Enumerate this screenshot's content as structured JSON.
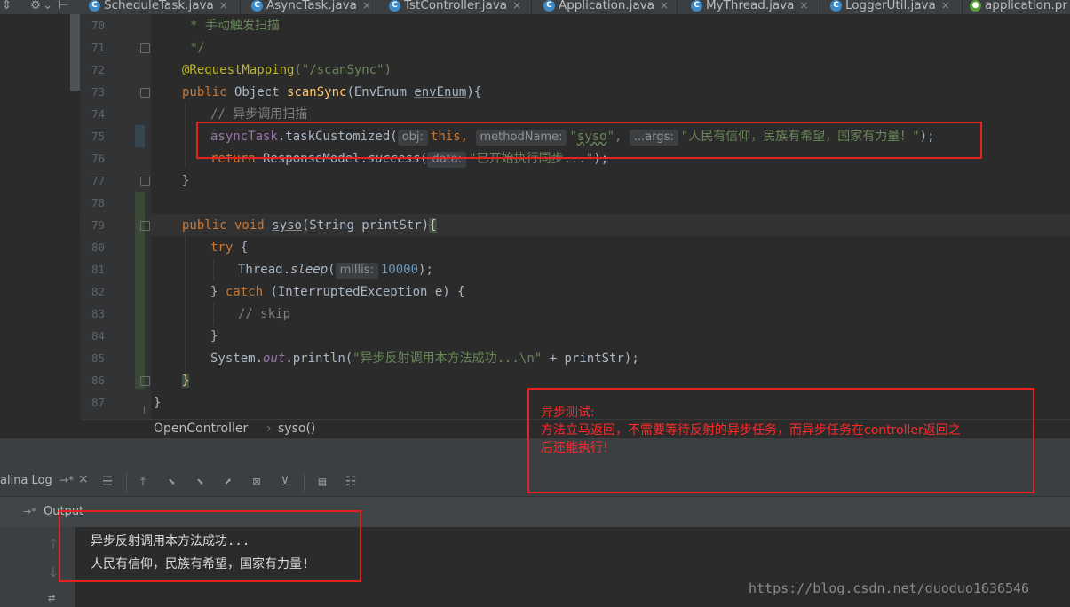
{
  "tabs": [
    {
      "label": "ScheduleTask.java",
      "close": "×"
    },
    {
      "label": "AsyncTask.java",
      "close": "×"
    },
    {
      "label": "TstController.java",
      "close": "×"
    },
    {
      "label": "Application.java",
      "close": "×"
    },
    {
      "label": "MyThread.java",
      "close": "×"
    },
    {
      "label": "LoggerUtil.java",
      "close": "×"
    },
    {
      "label": "application.pr",
      "close": ""
    }
  ],
  "line_numbers": [
    "70",
    "71",
    "72",
    "73",
    "74",
    "75",
    "76",
    "77",
    "78",
    "79",
    "80",
    "81",
    "82",
    "83",
    "84",
    "85",
    "86",
    "87"
  ],
  "code": {
    "l70": "* 手动触发扫描",
    "l71": "*/",
    "l72_ann": "@RequestMapping",
    "l72_str": "(\"/scanSync\")",
    "l73_kw": "public",
    "l73_type": " Object ",
    "l73_fn": "scanSync",
    "l73_rest_a": "(EnvEnum ",
    "l73_param": "envEnum",
    "l73_rest_b": "){",
    "l74": "// 异步调用扫描",
    "l75_obj": "asyncTask",
    "l75_call": ".taskCustomized(",
    "l75_hint1": "obj:",
    "l75_this": "this,",
    "l75_hint2": "methodName:",
    "l75_str1a": "\"",
    "l75_str1b": "syso",
    "l75_str1c": "\",",
    "l75_hint3": "...args:",
    "l75_str2": "\"人民有信仰，民族有希望，国家有力量！\"",
    "l75_end": ");",
    "l76_kw": "return",
    "l76_cls": " ResponseModel.",
    "l76_fn": "success",
    "l76_open": "(",
    "l76_hint": "data:",
    "l76_str": "\"已开始执行同步...\"",
    "l76_end": ");",
    "l77": "}",
    "l79_kw1": "public",
    "l79_kw2": " void ",
    "l79_fn": "syso",
    "l79_rest": "(String printStr)",
    "l79_brace": "{",
    "l80_kw": "try",
    "l80_rest": " {",
    "l81_cls": "Thread.",
    "l81_fn": "sleep",
    "l81_open": "(",
    "l81_hint": "millis:",
    "l81_num": "10000",
    "l81_end": ");",
    "l82_a": "} ",
    "l82_kw": "catch",
    "l82_rest": " (InterruptedException e) {",
    "l83": "// skip",
    "l84": "}",
    "l85_cls": "System.",
    "l85_fld": "out",
    "l85_call": ".println(",
    "l85_str": "\"异步反射调用本方法成功...\\n\"",
    "l85_rest": " + printStr);",
    "l86": "}",
    "l87": "}"
  },
  "breadcrumb": {
    "class": "OpenController",
    "sep": "›",
    "method": "syso()"
  },
  "panel": {
    "title": "alina Log",
    "pin": "→*",
    "close": "×",
    "output_label": "Output"
  },
  "annotation": {
    "line1": "异步测试:",
    "line2": "方法立马返回，不需要等待反射的异步任务，而异步任务在controller返回之",
    "line3": "后还能执行!"
  },
  "output_lines": [
    "异步反射调用本方法成功...",
    "人民有信仰，民族有希望，国家有力量!"
  ],
  "watermark": "https://blog.csdn.net/duoduo1636546",
  "colors": {
    "editor_bg": "#2b2b2b",
    "keyword": "#cc7832",
    "string": "#6a8759",
    "annotation_box": "#e52222"
  }
}
